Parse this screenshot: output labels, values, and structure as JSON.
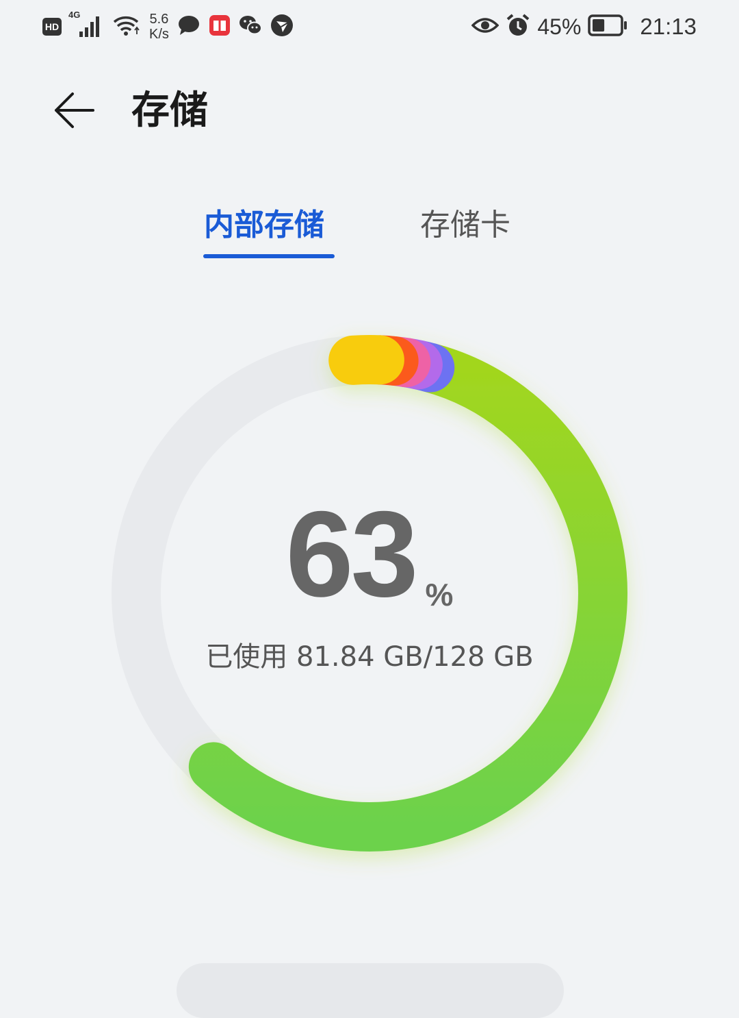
{
  "status_bar": {
    "hd": "HD",
    "network": "4G",
    "speed_value": "5.6",
    "speed_unit": "K/s",
    "battery_percent": "45%",
    "battery_fraction": 0.45,
    "time": "21:13"
  },
  "header": {
    "title": "存储"
  },
  "tabs": [
    {
      "label": "内部存储",
      "active": true
    },
    {
      "label": "存储卡",
      "active": false
    }
  ],
  "storage": {
    "percent_value": "63",
    "percent_sign": "%",
    "usage_text": "已使用 81.84 GB/128 GB",
    "used_fraction": 0.63,
    "segments": [
      {
        "name": "green",
        "color": "#7fd23c"
      },
      {
        "name": "blue",
        "color": "#6d72f2"
      },
      {
        "name": "purple",
        "color": "#b36bea"
      },
      {
        "name": "pink",
        "color": "#ee62a6"
      },
      {
        "name": "red",
        "color": "#fb5a1d"
      },
      {
        "name": "yellow",
        "color": "#f8cc0a"
      }
    ],
    "track_color": "#e8eaed"
  },
  "colors": {
    "accent": "#1a5bd6",
    "background": "#f1f3f5"
  }
}
